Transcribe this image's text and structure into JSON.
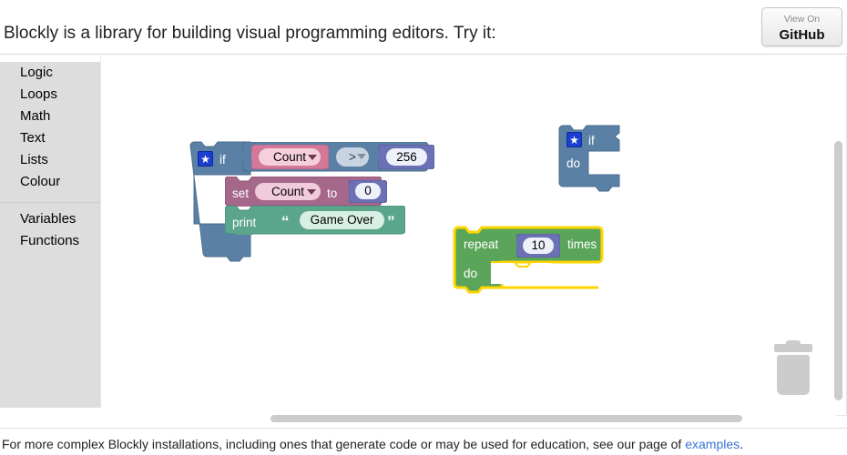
{
  "header": {
    "title": "Blockly is a library for building visual programming editors. Try it:",
    "github_button": {
      "top_label": "View On",
      "bottom_label": "GitHub"
    }
  },
  "toolbox": {
    "categories": [
      {
        "label": "Logic"
      },
      {
        "label": "Loops"
      },
      {
        "label": "Math"
      },
      {
        "label": "Text"
      },
      {
        "label": "Lists"
      },
      {
        "label": "Colour"
      }
    ],
    "categories_secondary": [
      {
        "label": "Variables"
      },
      {
        "label": "Functions"
      }
    ]
  },
  "workspace": {
    "blocks": {
      "if_main": {
        "type": "controls_if",
        "mutator_icon": "star-icon",
        "if_label": "if",
        "do_label": "do",
        "color": "#5b80a5",
        "condition": {
          "type": "logic_compare",
          "color": "#5b80a5",
          "left_variable": "Count",
          "operator": ">",
          "right_number": "256",
          "variable_color": "#d4789a",
          "number_color": "#6b71b5"
        },
        "statements": [
          {
            "type": "variables_set",
            "color": "#a5678a",
            "set_label": "set",
            "variable": "Count",
            "to_label": "to",
            "value": "0",
            "value_color": "#6b71b5"
          },
          {
            "type": "text_print",
            "color": "#5ba58c",
            "print_label": "print",
            "quote_open": "“",
            "text_value": "Game Over",
            "quote_close": "”"
          }
        ]
      },
      "if_empty": {
        "type": "controls_if",
        "mutator_icon": "star-icon",
        "if_label": "if",
        "do_label": "do",
        "color": "#5b80a5"
      },
      "repeat": {
        "type": "controls_repeat_ext",
        "repeat_label": "repeat",
        "times_label": "times",
        "do_label": "do",
        "count": "10",
        "color": "#5ba55b",
        "selected": true,
        "highlight_color": "#ffd500",
        "count_color": "#6b71b5"
      }
    },
    "trash_icon": "trash-icon",
    "vertical_scrollbar": "vertical-scrollbar",
    "horizontal_scrollbar": "horizontal-scrollbar"
  },
  "footer": {
    "text_before": "For more complex Blockly installations, including ones that generate code or may be used for education, see our page of ",
    "link_label": "examples",
    "text_after": "."
  }
}
